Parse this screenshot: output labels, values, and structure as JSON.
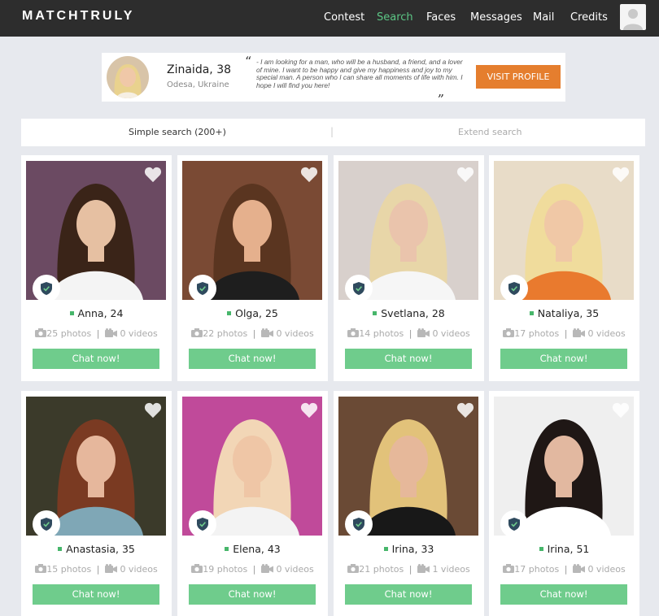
{
  "header": {
    "logo": "MATCHTRULY",
    "nav": [
      {
        "label": "Contest",
        "active": false
      },
      {
        "label": "Search",
        "active": true
      },
      {
        "label": "Faces",
        "active": false
      },
      {
        "label": "Messages",
        "active": false
      },
      {
        "label": "Mail",
        "active": false
      },
      {
        "label": "Credits",
        "active": false
      }
    ]
  },
  "featured": {
    "name": "Zinaida, 38",
    "location": "Odesa, Ukraine",
    "quote": "- I am looking for a man, who will be a husband, a friend, and a lover of mine. I want to be happy and give my happiness and joy to my special man. A person who I can share all moments of life with him. I hope I will find you here!",
    "open_quote_mark": "“",
    "close_quote_mark": "„",
    "button": "VISIT PROFILE"
  },
  "search_tabs": {
    "simple": "Simple search (200+)",
    "separator": "|",
    "extended": "Extend search"
  },
  "profiles": [
    {
      "name": "Anna, 24",
      "photos": "25 photos",
      "videos": "0 videos",
      "button": "Chat now!"
    },
    {
      "name": "Olga, 25",
      "photos": "22 photos",
      "videos": "0 videos",
      "button": "Chat now!"
    },
    {
      "name": "Svetlana, 28",
      "photos": "14 photos",
      "videos": "0 videos",
      "button": "Chat now!"
    },
    {
      "name": "Nataliya, 35",
      "photos": "17 photos",
      "videos": "0 videos",
      "button": "Chat now!"
    },
    {
      "name": "Anastasia, 35",
      "photos": "15 photos",
      "videos": "0 videos",
      "button": "Chat now!"
    },
    {
      "name": "Elena, 43",
      "photos": "19 photos",
      "videos": "0 videos",
      "button": "Chat now!"
    },
    {
      "name": "Irina, 33",
      "photos": "21 photos",
      "videos": "1 videos",
      "button": "Chat now!"
    },
    {
      "name": "Irina, 51",
      "photos": "17 photos",
      "videos": "0 videos",
      "button": "Chat now!"
    }
  ],
  "stats_separator": "|",
  "colors": {
    "topbar": "#2d2d2d",
    "active_nav": "#5cc685",
    "visit_button": "#e57e2e",
    "chat_button": "#6fcc8c",
    "online_indicator": "#47b66b",
    "page_background": "#e7e9ee"
  },
  "icons": [
    "user-avatar-icon",
    "heart-icon",
    "shield-check-icon",
    "camera-icon",
    "video-camera-icon"
  ]
}
